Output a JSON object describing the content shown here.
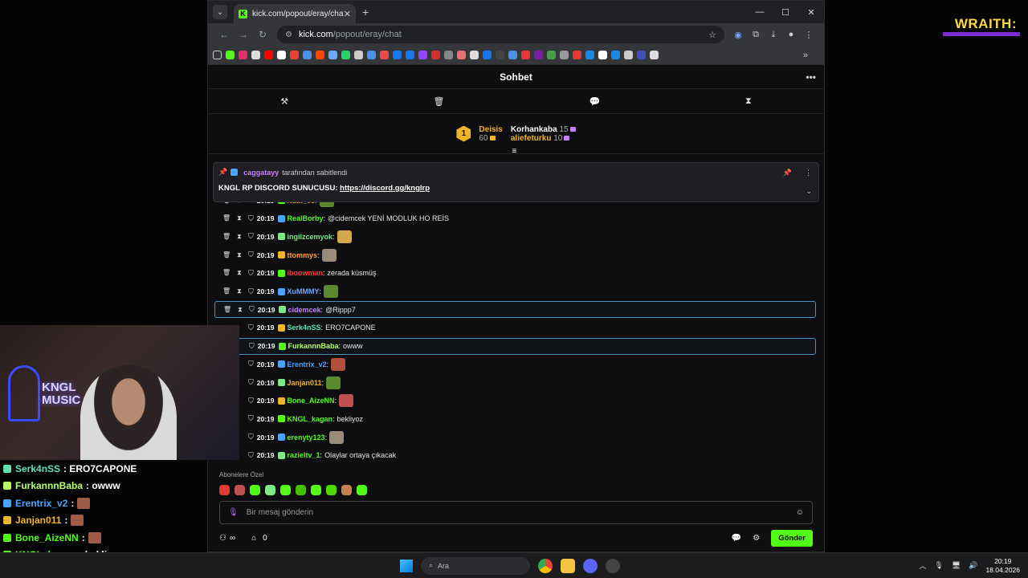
{
  "browser": {
    "tab_title": "kick.com/popout/eray/chat",
    "url_host": "kick.com",
    "url_path": "/popout/eray/chat"
  },
  "chat": {
    "header_title": "Sohbet",
    "leaderboard": {
      "first": {
        "rank": "1",
        "name": "Deisis",
        "points": "60"
      },
      "second": {
        "name": "Korhankaba",
        "points": "15"
      },
      "third": {
        "name": "aliefeturku",
        "points": "10"
      }
    },
    "pinned": {
      "by_user": "caggatayy",
      "by_suffix": "tarafından sabitlendi",
      "text": "KNGL RP DISCORD SUNUCUSU:",
      "link": "https://discord.gg/knglrp"
    },
    "messages": [
      {
        "time": "20:19",
        "user": "Natil_06",
        "color": "#f0b429",
        "text": "",
        "emote": true
      },
      {
        "time": "20:19",
        "user": "RealBorby",
        "color": "#53fc18",
        "text": "@cidemcek YENİ MODLUK HO REİS",
        "emote": false
      },
      {
        "time": "20:19",
        "user": "ingilzcemyok",
        "color": "#7ee787",
        "text": "",
        "emote": true
      },
      {
        "time": "20:19",
        "user": "ttommys",
        "color": "#ff9f43",
        "text": "",
        "emote": true
      },
      {
        "time": "20:19",
        "user": "iboowman",
        "color": "#ff3b3b",
        "text": "zerada küsmüş",
        "emote": false
      },
      {
        "time": "20:19",
        "user": "XuMMMY",
        "color": "#6ea8ff",
        "text": "",
        "emote": true
      },
      {
        "time": "20:19",
        "user": "cidemcek",
        "color": "#c77dff",
        "text": "@Rippp7",
        "emote": false
      },
      {
        "time": "20:19",
        "user": "Serk4nSS",
        "color": "#5fe3b0",
        "text": "ERO7CAPONE",
        "emote": false
      },
      {
        "time": "20:19",
        "user": "FurkannnBaba",
        "color": "#b6ff6b",
        "text": "owww",
        "emote": false
      },
      {
        "time": "20:19",
        "user": "Erentrix_v2",
        "color": "#4aa3ff",
        "text": "",
        "emote": true
      },
      {
        "time": "20:19",
        "user": "Janjan011",
        "color": "#f0b429",
        "text": "",
        "emote": true
      },
      {
        "time": "20:19",
        "user": "Bone_AizeNN",
        "color": "#53fc18",
        "text": "",
        "emote": true
      },
      {
        "time": "20:19",
        "user": "KNGL_kagan",
        "color": "#53fc18",
        "text": "bekliyoz",
        "emote": false
      },
      {
        "time": "20:19",
        "user": "erenyty123",
        "color": "#53fc18",
        "text": "",
        "emote": true
      },
      {
        "time": "20:19",
        "user": "razieltv_1",
        "color": "#53fc18",
        "text": "Olaylar ortaya çıkacak",
        "emote": false
      }
    ],
    "subs_label": "Abonelere Özel",
    "input_placeholder": "Bir mesaj gönderin",
    "footer": {
      "points": "∞",
      "store_count": "0",
      "send_label": "Gönder"
    }
  },
  "overlay": {
    "cam_text": "KNGL\nMUSIC",
    "brand": "WRAITH:",
    "chat": [
      {
        "user": "Serk4nSS",
        "color": "#5fe3b0",
        "text": ": ERO7CAPONE",
        "emote": false
      },
      {
        "user": "FurkannnBaba",
        "color": "#b6ff6b",
        "text": ": owww",
        "emote": false
      },
      {
        "user": "Erentrix_v2",
        "color": "#4aa3ff",
        "text": ":",
        "emote": true
      },
      {
        "user": "Janjan011",
        "color": "#f0b429",
        "text": ":",
        "emote": true
      },
      {
        "user": "Bone_AizeNN",
        "color": "#53fc18",
        "text": ":",
        "emote": true
      },
      {
        "user": "KNGL_kagan",
        "color": "#53fc18",
        "text": ": bekliyoz",
        "emote": false
      },
      {
        "user": "erenyty123",
        "color": "#53fc18",
        "text": ":",
        "emote": true
      }
    ]
  },
  "taskbar": {
    "search_label": "Ara",
    "time": "20:19",
    "date": "18.04.2026"
  }
}
